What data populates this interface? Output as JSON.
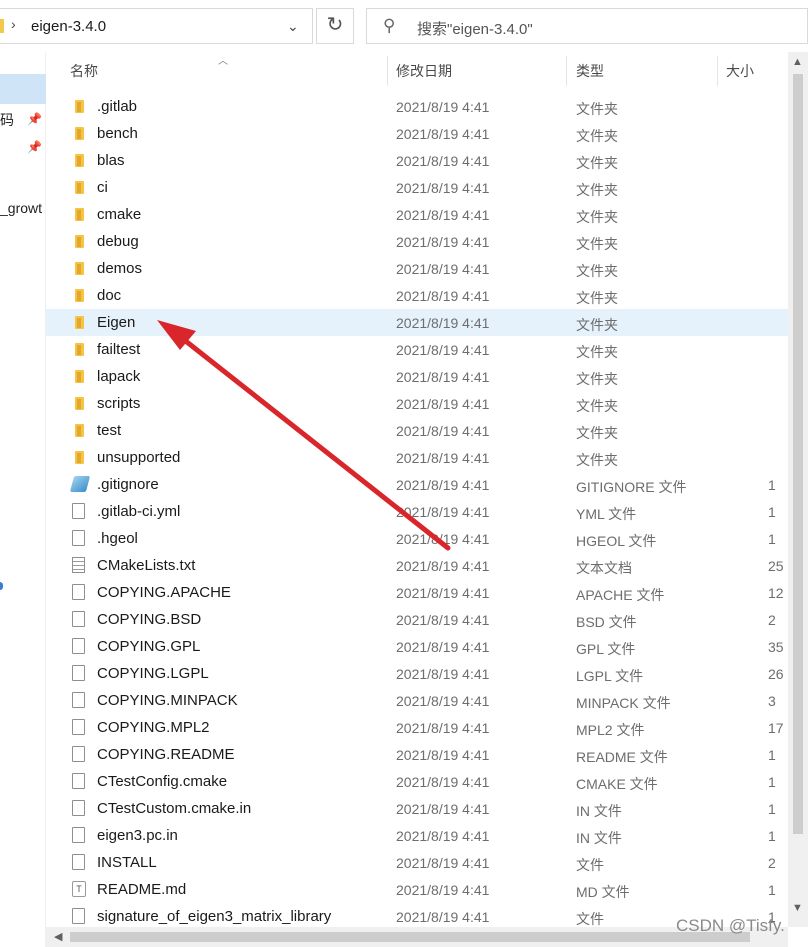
{
  "address_bar": {
    "path": "eigen-3.4.0",
    "separator": "›",
    "dropdown": "⌄"
  },
  "refresh_label": "↻",
  "search": {
    "placeholder": "搜索\"eigen-3.4.0\"",
    "icon": "search-icon"
  },
  "nav_pane": {
    "item_1": "码",
    "item_2": "_growt"
  },
  "columns": {
    "name": "名称",
    "date": "修改日期",
    "type": "类型",
    "size": "大小"
  },
  "files": [
    {
      "name": ".gitlab",
      "date": "2021/8/19 4:41",
      "type": "文件夹",
      "size": "",
      "icon": "folder"
    },
    {
      "name": "bench",
      "date": "2021/8/19 4:41",
      "type": "文件夹",
      "size": "",
      "icon": "folder"
    },
    {
      "name": "blas",
      "date": "2021/8/19 4:41",
      "type": "文件夹",
      "size": "",
      "icon": "folder"
    },
    {
      "name": "ci",
      "date": "2021/8/19 4:41",
      "type": "文件夹",
      "size": "",
      "icon": "folder"
    },
    {
      "name": "cmake",
      "date": "2021/8/19 4:41",
      "type": "文件夹",
      "size": "",
      "icon": "folder"
    },
    {
      "name": "debug",
      "date": "2021/8/19 4:41",
      "type": "文件夹",
      "size": "",
      "icon": "folder"
    },
    {
      "name": "demos",
      "date": "2021/8/19 4:41",
      "type": "文件夹",
      "size": "",
      "icon": "folder"
    },
    {
      "name": "doc",
      "date": "2021/8/19 4:41",
      "type": "文件夹",
      "size": "",
      "icon": "folder"
    },
    {
      "name": "Eigen",
      "date": "2021/8/19 4:41",
      "type": "文件夹",
      "size": "",
      "icon": "folder",
      "highlighted": true
    },
    {
      "name": "failtest",
      "date": "2021/8/19 4:41",
      "type": "文件夹",
      "size": "",
      "icon": "folder"
    },
    {
      "name": "lapack",
      "date": "2021/8/19 4:41",
      "type": "文件夹",
      "size": "",
      "icon": "folder"
    },
    {
      "name": "scripts",
      "date": "2021/8/19 4:41",
      "type": "文件夹",
      "size": "",
      "icon": "folder"
    },
    {
      "name": "test",
      "date": "2021/8/19 4:41",
      "type": "文件夹",
      "size": "",
      "icon": "folder"
    },
    {
      "name": "unsupported",
      "date": "2021/8/19 4:41",
      "type": "文件夹",
      "size": "",
      "icon": "folder"
    },
    {
      "name": ".gitignore",
      "date": "2021/8/19 4:41",
      "type": "GITIGNORE 文件",
      "size": "1",
      "icon": "git"
    },
    {
      "name": ".gitlab-ci.yml",
      "date": "2021/8/19 4:41",
      "type": "YML 文件",
      "size": "1",
      "icon": "file"
    },
    {
      "name": ".hgeol",
      "date": "2021/8/19 4:41",
      "type": "HGEOL 文件",
      "size": "1",
      "icon": "file"
    },
    {
      "name": "CMakeLists.txt",
      "date": "2021/8/19 4:41",
      "type": "文本文档",
      "size": "25",
      "icon": "text"
    },
    {
      "name": "COPYING.APACHE",
      "date": "2021/8/19 4:41",
      "type": "APACHE 文件",
      "size": "12",
      "icon": "file"
    },
    {
      "name": "COPYING.BSD",
      "date": "2021/8/19 4:41",
      "type": "BSD 文件",
      "size": "2",
      "icon": "file"
    },
    {
      "name": "COPYING.GPL",
      "date": "2021/8/19 4:41",
      "type": "GPL 文件",
      "size": "35",
      "icon": "file"
    },
    {
      "name": "COPYING.LGPL",
      "date": "2021/8/19 4:41",
      "type": "LGPL 文件",
      "size": "26",
      "icon": "file"
    },
    {
      "name": "COPYING.MINPACK",
      "date": "2021/8/19 4:41",
      "type": "MINPACK 文件",
      "size": "3",
      "icon": "file"
    },
    {
      "name": "COPYING.MPL2",
      "date": "2021/8/19 4:41",
      "type": "MPL2 文件",
      "size": "17",
      "icon": "file"
    },
    {
      "name": "COPYING.README",
      "date": "2021/8/19 4:41",
      "type": "README 文件",
      "size": "1",
      "icon": "file"
    },
    {
      "name": "CTestConfig.cmake",
      "date": "2021/8/19 4:41",
      "type": "CMAKE 文件",
      "size": "1",
      "icon": "file"
    },
    {
      "name": "CTestCustom.cmake.in",
      "date": "2021/8/19 4:41",
      "type": "IN 文件",
      "size": "1",
      "icon": "file"
    },
    {
      "name": "eigen3.pc.in",
      "date": "2021/8/19 4:41",
      "type": "IN 文件",
      "size": "1",
      "icon": "file"
    },
    {
      "name": "INSTALL",
      "date": "2021/8/19 4:41",
      "type": "文件",
      "size": "2",
      "icon": "file"
    },
    {
      "name": "README.md",
      "date": "2021/8/19 4:41",
      "type": "MD 文件",
      "size": "1",
      "icon": "md"
    },
    {
      "name": "signature_of_eigen3_matrix_library",
      "date": "2021/8/19 4:41",
      "type": "文件",
      "size": "1",
      "icon": "file"
    }
  ],
  "watermark": "CSDN @Tisfy.",
  "colors": {
    "highlight_row": "#e5f1fb",
    "annotation_arrow": "#d9262b",
    "folder": "#f6c343"
  }
}
